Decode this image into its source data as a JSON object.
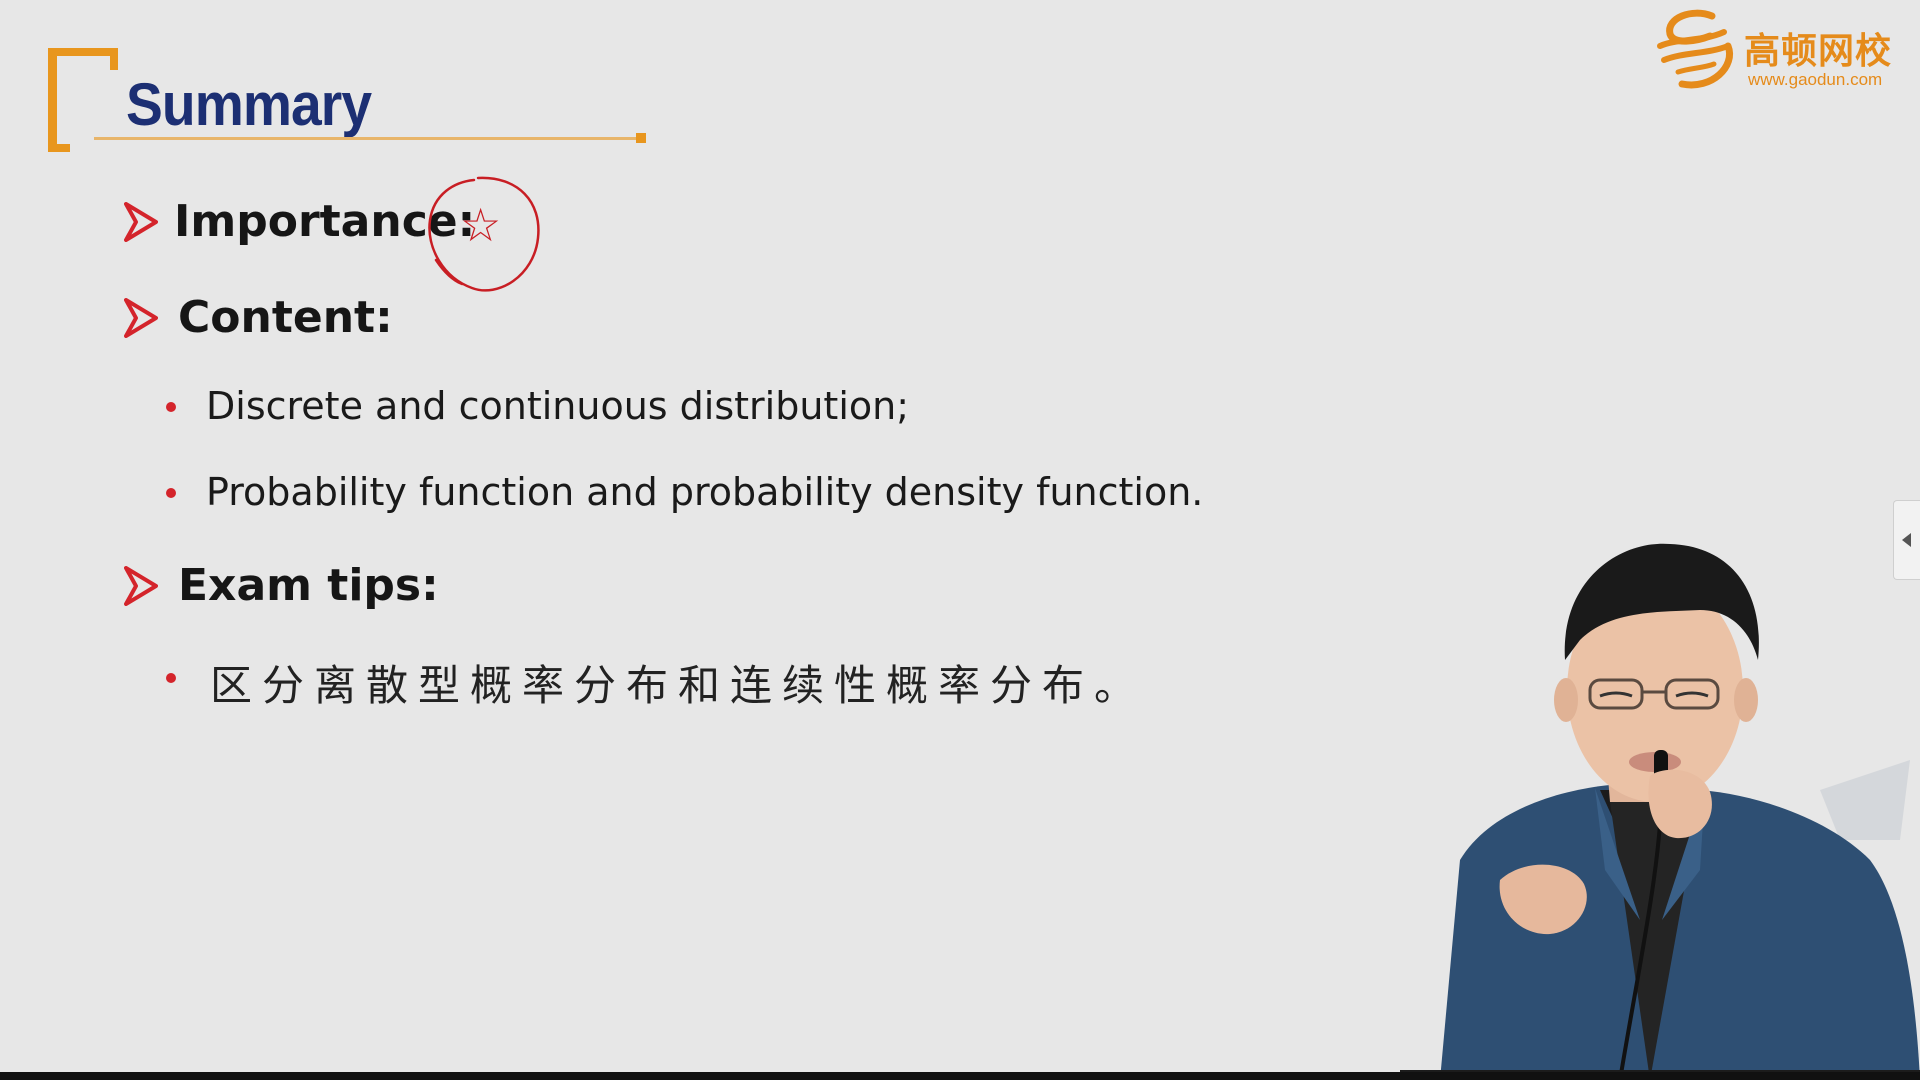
{
  "slide": {
    "title": "Summary",
    "logo": {
      "name": "高顿网校",
      "url": "www.gaodun.com"
    },
    "importance": {
      "label": "Importance:",
      "rating_symbol": "☆"
    },
    "content": {
      "label": "Content:",
      "items": [
        "Discrete and continuous distribution;",
        "Probability function and probability density function."
      ]
    },
    "exam_tips": {
      "label": "Exam tips:",
      "items": [
        "区分离散型概率分布和连续性概率分布。"
      ]
    }
  },
  "colors": {
    "accent_red": "#d4242b",
    "title_navy": "#1c2f73",
    "brand_orange": "#e58b1b",
    "background": "#e7e7e7"
  },
  "icons": {
    "heading_marker": "arrow-right-icon",
    "list_marker": "bullet-icon",
    "side_toggle": "chevron-left-icon"
  }
}
